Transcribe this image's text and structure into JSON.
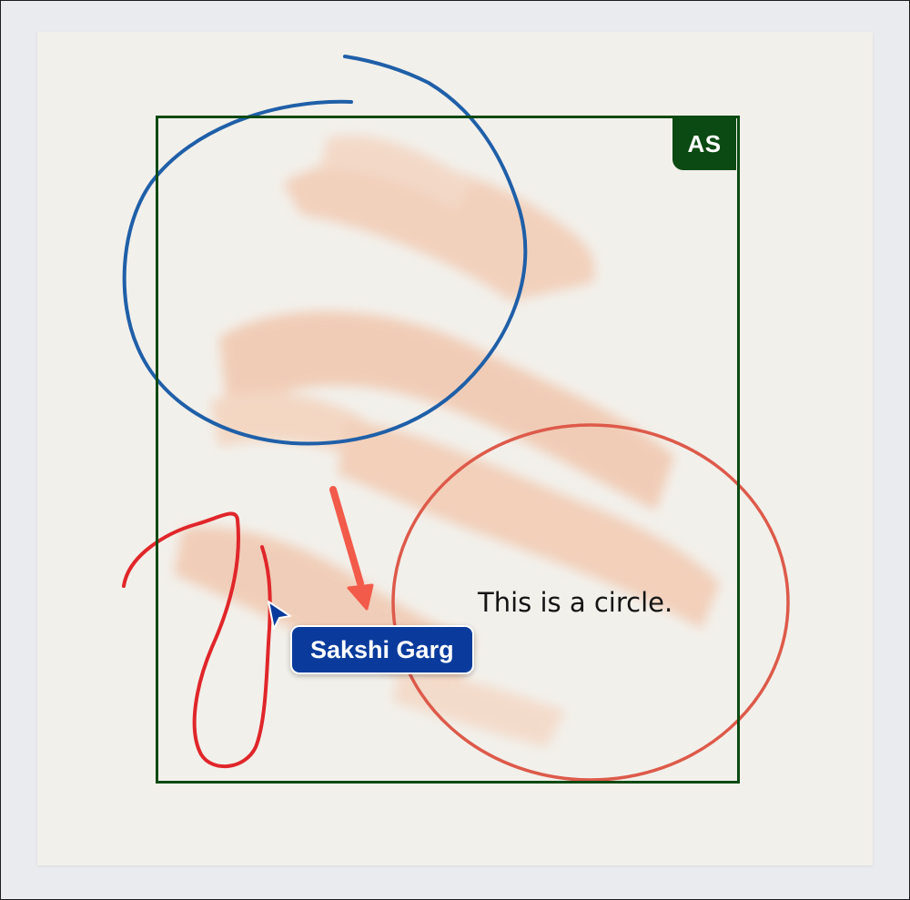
{
  "canvas": {
    "owner_badge": "AS",
    "circle_caption": "This is a circle."
  },
  "collaborator": {
    "name": "Sakshi Garg",
    "color": "#0a3b9c"
  },
  "colors": {
    "frame": "#0b4a12",
    "blue_stroke": "#1f5fa8",
    "red_stroke": "#e0262a",
    "circle_stroke": "#dd5a4a",
    "arrow": "#f25a4a",
    "watercolor": "#f2c2a5"
  }
}
